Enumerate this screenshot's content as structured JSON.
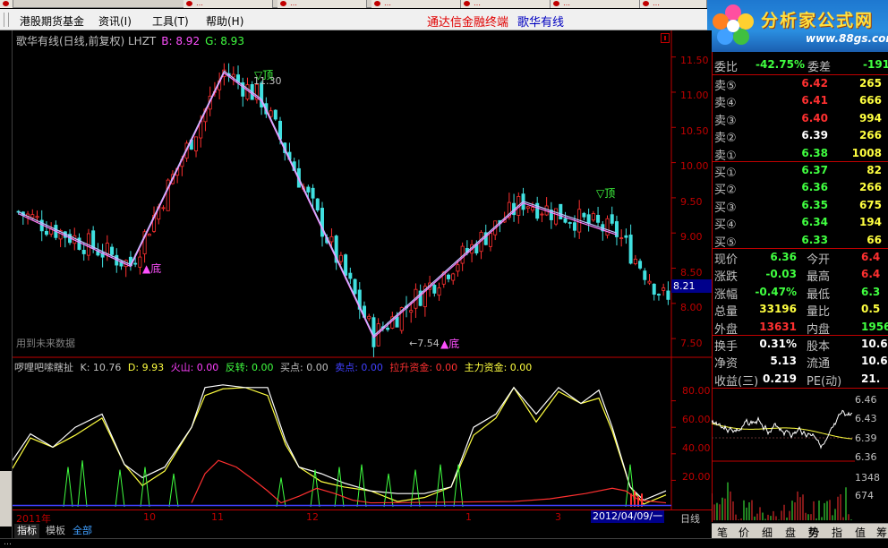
{
  "taskbar": {
    "items": [
      "…",
      "…",
      "…",
      "…",
      "…",
      "…"
    ]
  },
  "menu": {
    "items": [
      "港股期货基金",
      "资讯(I)",
      "工具(T)",
      "帮助(H)"
    ],
    "banner_left": "通达信金融终端",
    "banner_right": "歌华有线"
  },
  "logo": {
    "title": "分析家公式网",
    "url": "www.88gs.com"
  },
  "chart": {
    "header": "歌华有线(日线,前复权) LHZT",
    "b_label": "B: 8.92",
    "g_label": "G: 8.93",
    "watermark": "用到未来数据",
    "cursor_price": "8.21",
    "annotations": {
      "top1": "▽顶",
      "top1_price": "11.30",
      "top2": "▽顶",
      "bottom1": "底",
      "bottom2": "底",
      "bottom2_price": "7.54"
    },
    "colors": {
      "up": "#ff3030",
      "down": "#40e0e0",
      "zigzag_a": "#c0c0ff",
      "zigzag_b": "#ff80ff"
    }
  },
  "chart_data": {
    "type": "candlestick",
    "title": "歌华有线(日线,前复权)",
    "y_ticks": [
      11.5,
      11.0,
      10.5,
      10.0,
      9.5,
      9.0,
      8.5,
      8.0,
      7.5
    ],
    "ylim": [
      7.4,
      11.75
    ],
    "x_tick_labels": [
      "2011年",
      "10",
      "11",
      "12",
      "1",
      "3",
      "2012/04/09/一"
    ],
    "zigzag": [
      {
        "i": 0,
        "v": 9.3
      },
      {
        "i": 24,
        "v": 8.55
      },
      {
        "i": 44,
        "v": 11.3
      },
      {
        "i": 52,
        "v": 10.9
      },
      {
        "i": 76,
        "v": 7.54
      },
      {
        "i": 108,
        "v": 9.45
      },
      {
        "i": 128,
        "v": 9.0
      }
    ]
  },
  "indicator": {
    "name": "啰哩吧嗦瞎扯",
    "items": [
      {
        "label": "K: 10.76",
        "color": "#c0c0c0"
      },
      {
        "label": "D: 9.93",
        "color": "#ffff40"
      },
      {
        "label": "火山: 0.00",
        "color": "#ff40ff"
      },
      {
        "label": "反转: 0.00",
        "color": "#40ff40"
      },
      {
        "label": "买点: 0.00",
        "color": "#c0c0c0"
      },
      {
        "label": "卖点: 0.00",
        "color": "#4040ff"
      },
      {
        "label": "拉升资金: 0.00",
        "color": "#ff3030"
      },
      {
        "label": "主力资金: 0.00",
        "color": "#ffff40"
      }
    ],
    "y_ticks": [
      80.0,
      60.0,
      40.0,
      20.0
    ]
  },
  "time_axis": {
    "labels": [
      "2011年",
      "10",
      "11",
      "12",
      "1",
      "3"
    ],
    "current_date": "2012/04/09/一",
    "period": "日线"
  },
  "tabs": [
    "指标",
    "模板",
    "全部"
  ],
  "status_text": "…",
  "quote": {
    "weibi_label": "委比",
    "weibi_value": "-42.75%",
    "weicha_label": "委差",
    "weicha_value": "-191",
    "asks": [
      {
        "label": "卖⑤",
        "price": "6.42",
        "vol": "265",
        "color": "#ff3030"
      },
      {
        "label": "卖④",
        "price": "6.41",
        "vol": "666",
        "color": "#ff3030"
      },
      {
        "label": "卖③",
        "price": "6.40",
        "vol": "994",
        "color": "#ff3030"
      },
      {
        "label": "卖②",
        "price": "6.39",
        "vol": "266",
        "color": "#ffffff"
      },
      {
        "label": "卖①",
        "price": "6.38",
        "vol": "1008",
        "color": "#40ff40"
      }
    ],
    "bids": [
      {
        "label": "买①",
        "price": "6.37",
        "vol": "82",
        "color": "#40ff40"
      },
      {
        "label": "买②",
        "price": "6.36",
        "vol": "266",
        "color": "#40ff40"
      },
      {
        "label": "买③",
        "price": "6.35",
        "vol": "675",
        "color": "#40ff40"
      },
      {
        "label": "买④",
        "price": "6.34",
        "vol": "194",
        "color": "#40ff40"
      },
      {
        "label": "买⑤",
        "price": "6.33",
        "vol": "66",
        "color": "#40ff40"
      }
    ],
    "stats": [
      {
        "l1": "现价",
        "v1": "6.36",
        "c1": "#40ff40",
        "l2": "今开",
        "v2": "6.4",
        "c2": "#ff3030"
      },
      {
        "l1": "涨跌",
        "v1": "-0.03",
        "c1": "#40ff40",
        "l2": "最高",
        "v2": "6.4",
        "c2": "#ff3030"
      },
      {
        "l1": "涨幅",
        "v1": "-0.47%",
        "c1": "#40ff40",
        "l2": "最低",
        "v2": "6.3",
        "c2": "#40ff40"
      },
      {
        "l1": "总量",
        "v1": "33196",
        "c1": "#ffff40",
        "l2": "量比",
        "v2": "0.5",
        "c2": "#ffff40"
      },
      {
        "l1": "外盘",
        "v1": "13631",
        "c1": "#ff3030",
        "l2": "内盘",
        "v2": "1956",
        "c2": "#40ff40"
      }
    ],
    "stats2": [
      {
        "l1": "换手",
        "v1": "0.31%",
        "c1": "#ffffff",
        "l2": "股本",
        "v2": "10.6",
        "c2": "#ffffff"
      },
      {
        "l1": "净资",
        "v1": "5.13",
        "c1": "#ffffff",
        "l2": "流通",
        "v2": "10.6",
        "c2": "#ffffff"
      },
      {
        "l1": "收益(三)",
        "v1": "0.219",
        "c1": "#ffffff",
        "l2": "PE(动)",
        "v2": "21.",
        "c2": "#ffffff"
      }
    ]
  },
  "mini": {
    "ticks": [
      {
        "label": "6.46",
        "color": "#ff3030"
      },
      {
        "label": "6.43",
        "color": "#ff3030"
      },
      {
        "label": "6.39",
        "color": "#ffffff"
      },
      {
        "label": "6.36",
        "color": "#40ff40"
      },
      {
        "label": "1348",
        "color": "#ffff40"
      },
      {
        "label": "674",
        "color": "#ffff40"
      }
    ]
  },
  "right_tabs": [
    "笔",
    "价",
    "细",
    "盘",
    "势",
    "指",
    "值",
    "筹"
  ]
}
